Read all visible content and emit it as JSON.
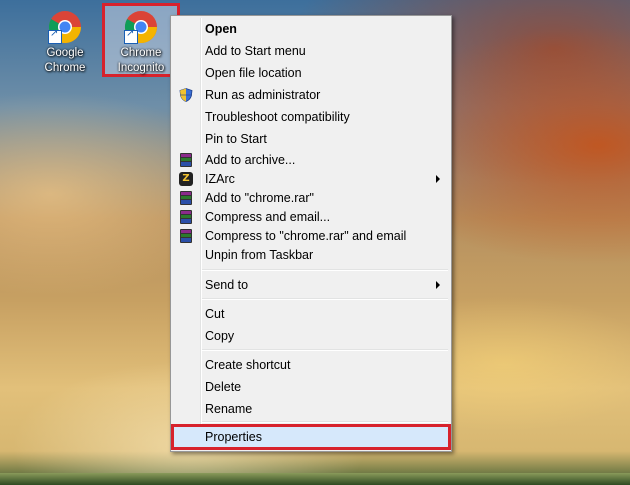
{
  "desktop": {
    "icons": [
      {
        "label_line1": "Google",
        "label_line2": "Chrome",
        "icon": "chrome-icon",
        "selected": false
      },
      {
        "label_line1": "Chrome",
        "label_line2": "Incognito",
        "icon": "chrome-icon",
        "selected": true
      }
    ]
  },
  "menu": {
    "items": [
      {
        "label": "Open",
        "bold": true
      },
      {
        "label": "Add to Start menu"
      },
      {
        "label": "Open file location"
      },
      {
        "label": "Run as administrator",
        "icon": "uac-shield-icon"
      },
      {
        "label": "Troubleshoot compatibility"
      },
      {
        "label": "Pin to Start"
      },
      {
        "label": "Add to archive...",
        "icon": "winrar-icon"
      },
      {
        "label": "IZArc",
        "icon": "izarc-icon",
        "submenu": true
      },
      {
        "label": "Add to \"chrome.rar\"",
        "icon": "winrar-icon"
      },
      {
        "label": "Compress and email...",
        "icon": "winrar-icon"
      },
      {
        "label": "Compress to \"chrome.rar\" and email",
        "icon": "winrar-icon"
      },
      {
        "label": "Unpin from Taskbar"
      },
      {
        "label": "Send to",
        "submenu": true
      },
      {
        "label": "Cut"
      },
      {
        "label": "Copy"
      },
      {
        "label": "Create shortcut"
      },
      {
        "label": "Delete"
      },
      {
        "label": "Rename"
      },
      {
        "label": "Properties",
        "highlighted": true
      }
    ]
  },
  "colors": {
    "highlight_border": "#d7222c",
    "menu_background": "#f0f0f0",
    "hover_background": "#d6e8fb"
  }
}
